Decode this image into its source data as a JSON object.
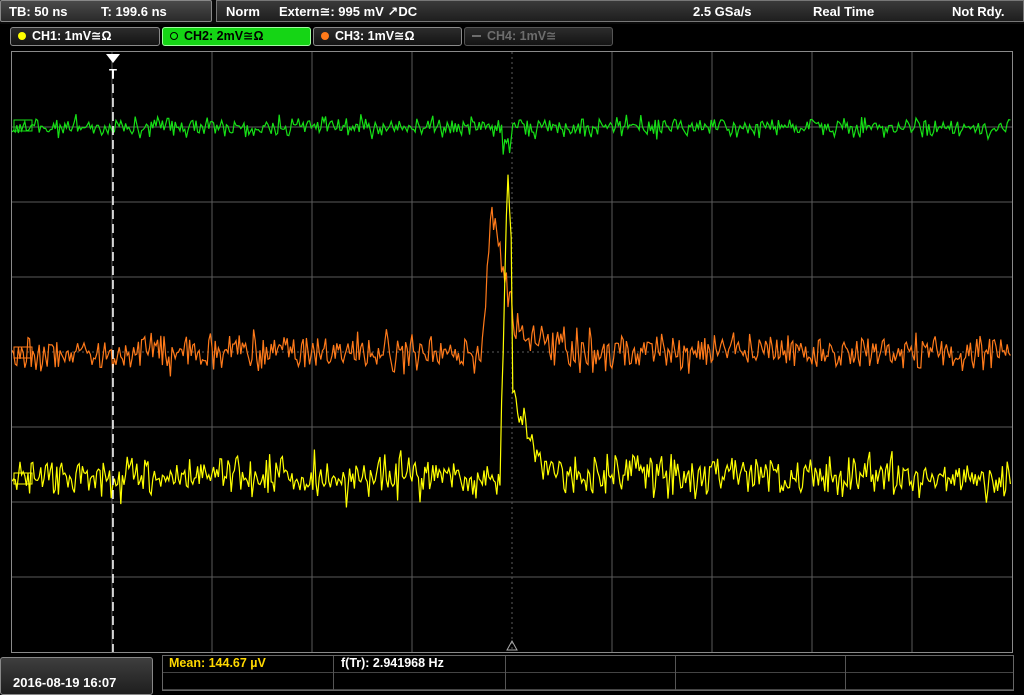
{
  "top": {
    "timebase": "TB: 50 ns",
    "trigger_time": "T: 199.6 ns",
    "mode": "Norm",
    "trigger_source": "Extern≅: 995 mV ↗DC",
    "sample_rate": "2.5 GSa/s",
    "acq_mode": "Real Time",
    "state": "Not Rdy."
  },
  "channels": [
    {
      "label": "CH1: 1mV≅Ω",
      "color": "#ffff00",
      "active": false,
      "enabled": true
    },
    {
      "label": "CH2: 2mV≅Ω",
      "color": "#16e016",
      "active": true,
      "enabled": true
    },
    {
      "label": "CH3: 1mV≅Ω",
      "color": "#ff7a1a",
      "active": false,
      "enabled": true
    },
    {
      "label": "CH4: 1mV≅",
      "color": "#6d6d6d",
      "active": false,
      "enabled": false
    }
  ],
  "trigger_marker": "T",
  "colors": {
    "ch1": "#ffff00",
    "ch2": "#16e016",
    "ch3": "#ff7a1a",
    "grid": "#5a5a5a",
    "trigger_line": "#ffffff"
  },
  "measurements": {
    "mean": "Mean: 144.67 µV",
    "freq": "f(Tr): 2.941968 Hz"
  },
  "timestamp": "2016-08-19 16:07"
}
